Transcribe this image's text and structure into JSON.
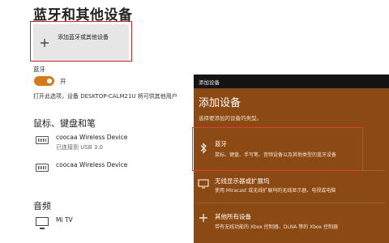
{
  "page": {
    "title": "蓝牙和其他设备",
    "add_device_label": "添加蓝牙或其他设备",
    "bluetooth_heading": "蓝牙",
    "toggle_state": "开",
    "discoverable_text": "打开此选项，设备 DESKTOP-CALM21U 将可供其他用户",
    "section_input": "鼠标、键盘和笔",
    "devices": [
      {
        "name": "coocaa Wireless Device",
        "status": "已连接到 USB 3.0"
      },
      {
        "name": "coocaa Wireless Device",
        "status": ""
      }
    ],
    "section_audio": "音频",
    "audio_device": "Mi TV"
  },
  "dialog": {
    "titlebar": "添加设备",
    "heading": "添加设备",
    "subtitle": "选择要添加的设备的类型。",
    "options": [
      {
        "icon": "bluetooth-icon",
        "title": "蓝牙",
        "desc": "鼠标、键盘、手写笔、音频设备以及其他类型的蓝牙设备"
      },
      {
        "icon": "monitor-icon",
        "title": "无线显示器或扩展坞",
        "desc": "使用 Miracast 或无线扩展坞的无线显示器、电视或电脑"
      },
      {
        "icon": "plus-icon",
        "title": "其他所有设备",
        "desc": "带有无线功能的 Xbox 控制器、DLNA 等的 Xbox 控制器"
      }
    ]
  },
  "colors": {
    "accent": "#d47a1e",
    "dialog_bg": "#8b4a13",
    "titlebar_bg": "#141414",
    "highlight": "#c62828"
  }
}
